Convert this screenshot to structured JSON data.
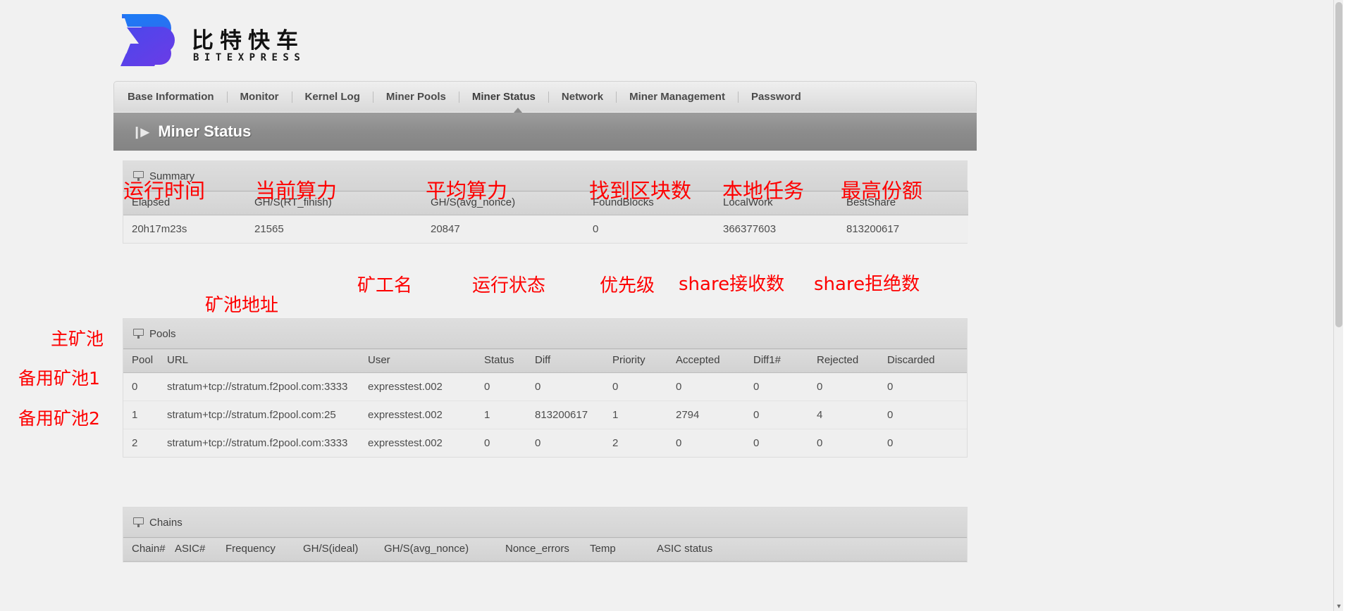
{
  "brand": {
    "name_cn": "比特快车",
    "name_en": "BITEXPRESS",
    "logo_colors": {
      "top": "#1b7cf5",
      "bottom": "#5a3ee8"
    }
  },
  "nav": {
    "items": [
      {
        "label": "Base Information",
        "active": false
      },
      {
        "label": "Monitor",
        "active": false
      },
      {
        "label": "Kernel Log",
        "active": false
      },
      {
        "label": "Miner Pools",
        "active": false
      },
      {
        "label": "Miner Status",
        "active": true
      },
      {
        "label": "Network",
        "active": false
      },
      {
        "label": "Miner Management",
        "active": false
      },
      {
        "label": "Password",
        "active": false
      }
    ]
  },
  "page_title": "Miner Status",
  "summary": {
    "section_label": "Summary",
    "columns": [
      "Elapsed",
      "GH/S(RT_finish)",
      "GH/S(avg_nonce)",
      "FoundBlocks",
      "LocalWork",
      "BestShare"
    ],
    "rows": [
      [
        "20h17m23s",
        "21565",
        "20847",
        "0",
        "366377603",
        "813200617"
      ]
    ],
    "annotations": [
      {
        "text": "运行时间",
        "for": "Elapsed"
      },
      {
        "text": "当前算力",
        "for": "GH/S(RT_finish)"
      },
      {
        "text": "平均算力",
        "for": "GH/S(avg_nonce)"
      },
      {
        "text": "找到区块数",
        "for": "FoundBlocks"
      },
      {
        "text": "本地任务",
        "for": "LocalWork"
      },
      {
        "text": "最高份额",
        "for": "BestShare"
      }
    ]
  },
  "pools": {
    "section_label": "Pools",
    "columns": [
      "Pool",
      "URL",
      "User",
      "Status",
      "Diff",
      "Priority",
      "Accepted",
      "Diff1#",
      "Rejected",
      "Discarded"
    ],
    "rows": [
      [
        "0",
        "stratum+tcp://stratum.f2pool.com:3333",
        "expresstest.002",
        "0",
        "0",
        "0",
        "0",
        "0",
        "0",
        "0"
      ],
      [
        "1",
        "stratum+tcp://stratum.f2pool.com:25",
        "expresstest.002",
        "1",
        "813200617",
        "1",
        "2794",
        "0",
        "4",
        "0"
      ],
      [
        "2",
        "stratum+tcp://stratum.f2pool.com:3333",
        "expresstest.002",
        "0",
        "0",
        "2",
        "0",
        "0",
        "0",
        "0"
      ]
    ],
    "annotations": [
      {
        "text": "矿池地址",
        "for": "URL"
      },
      {
        "text": "矿工名",
        "for": "User"
      },
      {
        "text": "运行状态",
        "for": "Status"
      },
      {
        "text": "优先级",
        "for": "Priority"
      },
      {
        "text": "share接收数",
        "for": "Accepted"
      },
      {
        "text": "share拒绝数",
        "for": "Rejected"
      }
    ],
    "row_annotations": [
      {
        "text": "主矿池",
        "for_row": 0
      },
      {
        "text": "备用矿池1",
        "for_row": 1
      },
      {
        "text": "备用矿池2",
        "for_row": 2
      }
    ]
  },
  "chains": {
    "section_label": "Chains",
    "columns": [
      "Chain#",
      "ASIC#",
      "Frequency",
      "GH/S(ideal)",
      "GH/S(avg_nonce)",
      "Nonce_errors",
      "Temp",
      "ASIC status"
    ]
  },
  "colors": {
    "annotation": "#fe0000",
    "title_bar": "#8c8c8c",
    "panel_header": "#d6d6d6",
    "text": "#4d4d4d"
  },
  "scrollbar": {
    "up": "▲",
    "down": "▼"
  }
}
